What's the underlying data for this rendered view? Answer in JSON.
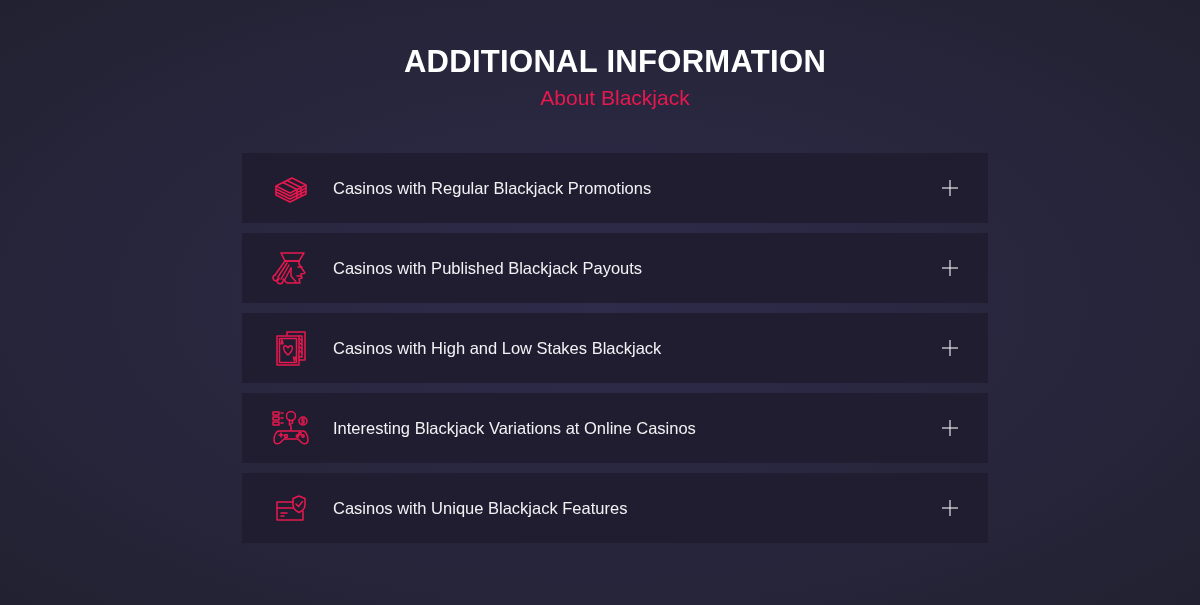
{
  "heading": {
    "title": "ADDITIONAL INFORMATION",
    "subtitle": "About Blackjack"
  },
  "accordion": [
    {
      "label": "Casinos with Regular Blackjack Promotions",
      "expanded": false
    },
    {
      "label": "Casinos with Published Blackjack Payouts",
      "expanded": false
    },
    {
      "label": "Casinos with High and Low Stakes Blackjack",
      "expanded": false
    },
    {
      "label": "Interesting Blackjack Variations at Online Casinos",
      "expanded": false
    },
    {
      "label": "Casinos with Unique Blackjack Features",
      "expanded": false
    }
  ]
}
